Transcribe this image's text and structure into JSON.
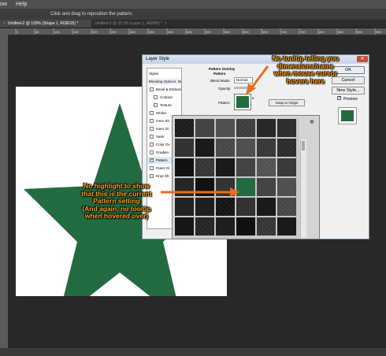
{
  "menubar": {
    "items": [
      "ow",
      "Help"
    ]
  },
  "options_bar": {
    "hint": "Click and drag to reposition the pattern."
  },
  "tabs": [
    {
      "label": "Untitled-2 @ 100% (Shape 1, RGB/16) *",
      "active": true
    },
    {
      "label": "Untitled-3 @ 33.3% (Layer 1, RGB/8) *",
      "active": false
    }
  ],
  "rulers": {
    "ticks": [
      "0",
      "50",
      "100",
      "150",
      "200",
      "250",
      "300",
      "350",
      "400",
      "450",
      "500",
      "550",
      "600",
      "650",
      "700",
      "750",
      "800",
      "850",
      "900",
      "950"
    ]
  },
  "canvas": {
    "shape_color": "#226b40"
  },
  "dialog": {
    "title": "Layer Style",
    "styles_list": [
      {
        "label": "Styles",
        "checkbox": false,
        "checked": false
      },
      {
        "label": "Blending Options: Default",
        "checkbox": false,
        "checked": false
      },
      {
        "label": "Bevel & Emboss",
        "checkbox": true,
        "checked": false
      },
      {
        "label": "Contour",
        "checkbox": true,
        "checked": false
      },
      {
        "label": "Texture",
        "checkbox": true,
        "checked": false
      },
      {
        "label": "Stroke",
        "checkbox": true,
        "checked": false
      },
      {
        "label": "Inner Sh",
        "checkbox": true,
        "checked": false
      },
      {
        "label": "Inner Gl",
        "checkbox": true,
        "checked": false
      },
      {
        "label": "Satin",
        "checkbox": true,
        "checked": false
      },
      {
        "label": "Color Ov",
        "checkbox": true,
        "checked": false
      },
      {
        "label": "Gradien",
        "checkbox": true,
        "checked": false
      },
      {
        "label": "Pattern",
        "checkbox": true,
        "checked": true
      },
      {
        "label": "Outer Gl",
        "checkbox": true,
        "checked": false
      },
      {
        "label": "Drop Sh",
        "checkbox": true,
        "checked": false
      }
    ],
    "section_title": "Pattern Overlay",
    "section_subtitle": "Pattern",
    "blend_mode_label": "Blend Mode:",
    "blend_mode_value": "Normal",
    "opacity_label": "Opacity:",
    "pattern_label": "Pattern:",
    "snap_button": "Snap to Origin",
    "ok_button": "OK",
    "cancel_button": "Cancel",
    "new_style_button": "New Style...",
    "preview_label": "Preview",
    "preview_checked": true,
    "pattern_color": "#226b40"
  },
  "annotations": {
    "top": [
      "No tooltip telling you",
      "dimensions/name",
      "when mouse cursor",
      "hovers here"
    ],
    "left": [
      "No highlight to show",
      "that this is the current",
      "Pattern setting",
      "(And again, no tooltip",
      "when hovered over)"
    ],
    "color": "#ffa21a"
  }
}
